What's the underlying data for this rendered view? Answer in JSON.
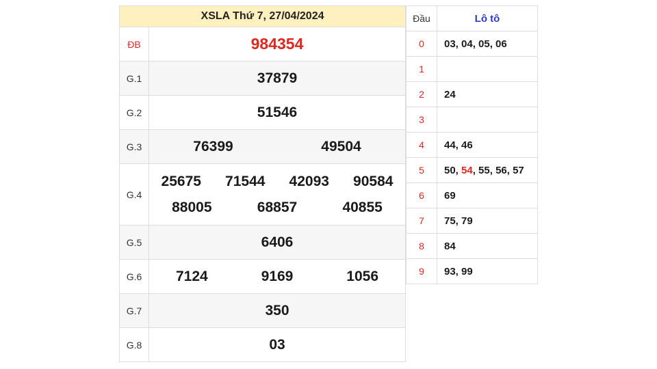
{
  "results": {
    "title": "XSLA Thứ 7, 27/04/2024",
    "rows": [
      {
        "label": "ĐB",
        "numbers": [
          "984354"
        ]
      },
      {
        "label": "G.1",
        "numbers": [
          "37879"
        ]
      },
      {
        "label": "G.2",
        "numbers": [
          "51546"
        ]
      },
      {
        "label": "G.3",
        "numbers": [
          "76399",
          "49504"
        ]
      },
      {
        "label": "G.4",
        "numbers": [
          "25675",
          "71544",
          "42093",
          "90584",
          "88005",
          "68857",
          "40855"
        ]
      },
      {
        "label": "G.5",
        "numbers": [
          "6406"
        ]
      },
      {
        "label": "G.6",
        "numbers": [
          "7124",
          "9169",
          "1056"
        ]
      },
      {
        "label": "G.7",
        "numbers": [
          "350"
        ]
      },
      {
        "label": "G.8",
        "numbers": [
          "03"
        ]
      }
    ]
  },
  "loto": {
    "header_dau": "Đầu",
    "header_loto": "Lô tô",
    "rows": [
      {
        "dau": "0",
        "values": "03, 04, 05, 06"
      },
      {
        "dau": "1",
        "values": ""
      },
      {
        "dau": "2",
        "values": "24"
      },
      {
        "dau": "3",
        "values": ""
      },
      {
        "dau": "4",
        "values": "44, 46"
      },
      {
        "dau": "5",
        "values_before": "50, ",
        "values_highlight": "54",
        "values_after": ", 55, 56, 57"
      },
      {
        "dau": "6",
        "values": "69"
      },
      {
        "dau": "7",
        "values": "75, 79"
      },
      {
        "dau": "8",
        "values": "84"
      },
      {
        "dau": "9",
        "values": "93, 99"
      }
    ]
  },
  "colors": {
    "accent_red": "#e0261f",
    "header_blue": "#2a3cc7",
    "title_bg": "#fff0c0"
  }
}
